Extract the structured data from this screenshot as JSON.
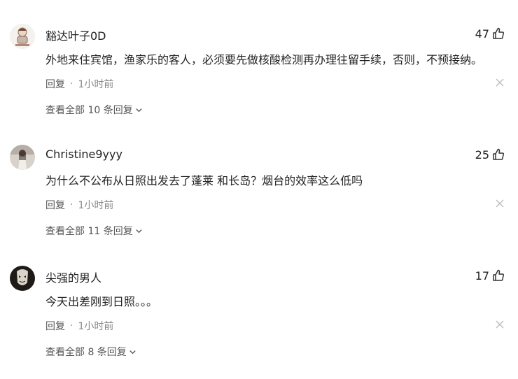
{
  "comments": [
    {
      "username": "豁达叶子0D",
      "likes": "47",
      "text": "外地来住宾馆，渔家乐的客人，必须要先做核酸检测再办理往留手续，否则，不预接纳。",
      "reply_label": "回复",
      "separator": "·",
      "time": "1小时前",
      "view_replies": "查看全部 10 条回复",
      "avatar_icon": "cartoon-avatar"
    },
    {
      "username": "Christine9yyy",
      "likes": "25",
      "text": "为什么不公布从日照出发去了蓬莱 和长岛？烟台的效率这么低吗",
      "reply_label": "回复",
      "separator": "·",
      "time": "1小时前",
      "view_replies": "查看全部 11 条回复",
      "avatar_icon": "person-photo-avatar"
    },
    {
      "username": "尖强的男人",
      "likes": "17",
      "text": "今天出差刚到日照。。。",
      "reply_label": "回复",
      "separator": "·",
      "time": "1小时前",
      "view_replies": "查看全部 8 条回复",
      "avatar_icon": "dark-mask-avatar"
    }
  ]
}
